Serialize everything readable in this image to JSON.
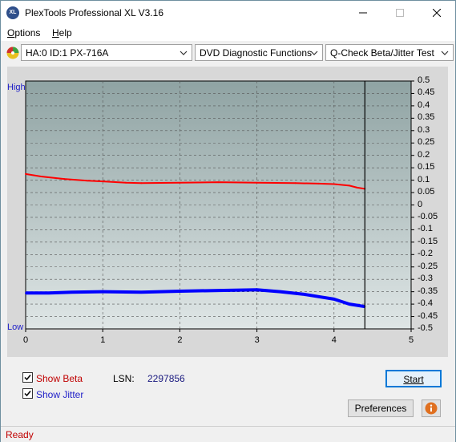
{
  "window": {
    "title": "PlexTools Professional XL V3.16",
    "icon": "XL"
  },
  "menu": [
    {
      "label": "Options",
      "accel": "O",
      "rest": "ptions"
    },
    {
      "label": "Help",
      "accel": "H",
      "rest": "elp"
    }
  ],
  "toolbar": {
    "drive": "HA:0 ID:1  PX-716A",
    "function": "DVD Diagnostic Functions",
    "test": "Q-Check Beta/Jitter Test"
  },
  "chart_data": {
    "type": "line",
    "y_left_labels": {
      "high": "High",
      "low": "Low"
    },
    "y_ticks": [
      "0.5",
      "0.45",
      "0.4",
      "0.35",
      "0.3",
      "0.25",
      "0.2",
      "0.15",
      "0.1",
      "0.05",
      "0",
      "-0.05",
      "-0.1",
      "-0.15",
      "-0.2",
      "-0.25",
      "-0.3",
      "-0.35",
      "-0.4",
      "-0.45",
      "-0.5"
    ],
    "x_ticks": [
      "0",
      "1",
      "2",
      "3",
      "4",
      "5"
    ],
    "xlim": [
      0,
      5
    ],
    "ylim": [
      -0.5,
      0.5
    ],
    "end_marker_x": 4.4,
    "grid": true,
    "colors": {
      "beta": "#ff0000",
      "jitter": "#0000ff",
      "plot_bg": "#a8b8b8"
    },
    "series": [
      {
        "name": "Beta",
        "x": [
          0,
          0.2,
          0.5,
          0.8,
          1.0,
          1.3,
          1.5,
          2.0,
          2.5,
          3.0,
          3.5,
          3.8,
          4.0,
          4.2,
          4.3,
          4.4
        ],
        "y": [
          0.125,
          0.115,
          0.105,
          0.098,
          0.095,
          0.09,
          0.088,
          0.09,
          0.092,
          0.09,
          0.088,
          0.086,
          0.084,
          0.078,
          0.07,
          0.065
        ]
      },
      {
        "name": "Jitter",
        "x": [
          0,
          0.3,
          0.6,
          1.0,
          1.5,
          2.0,
          2.5,
          3.0,
          3.3,
          3.6,
          3.8,
          4.0,
          4.1,
          4.2,
          4.3,
          4.4
        ],
        "y": [
          -0.355,
          -0.355,
          -0.352,
          -0.35,
          -0.352,
          -0.348,
          -0.345,
          -0.342,
          -0.35,
          -0.36,
          -0.37,
          -0.38,
          -0.39,
          -0.4,
          -0.405,
          -0.41
        ]
      }
    ]
  },
  "options": {
    "show_beta": {
      "label": "Show Beta",
      "checked": true
    },
    "show_jitter": {
      "label": "Show Jitter",
      "checked": true
    }
  },
  "lsn": {
    "label": "LSN:",
    "value": "2297856"
  },
  "buttons": {
    "start": "Start",
    "preferences": "Preferences"
  },
  "status": {
    "text": "Ready"
  }
}
